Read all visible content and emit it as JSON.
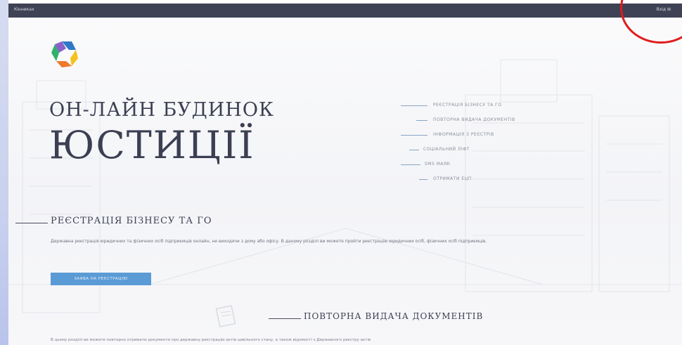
{
  "topbar": {
    "left_text": "Кінниках",
    "right_text": "Вхід ⊞"
  },
  "hero": {
    "line1": "ОН-ЛАЙН БУДИНОК",
    "line2": "ЮСТИЦІЇ"
  },
  "nav": {
    "items": [
      {
        "label": "РЕЄСТРАЦІЯ БІЗНЕСУ ТА ГО"
      },
      {
        "label": "ПОВТОРНА ВИДАЧА ДОКУМЕНТІВ"
      },
      {
        "label": "ІНФОРМАЦІЯ З РЕЄСТРІВ"
      },
      {
        "label": "СОЦІАЛЬНИЙ ЛІФТ"
      },
      {
        "label": "SMS МАЯК"
      },
      {
        "label": "ОТРИМАТИ ЕЦП"
      }
    ]
  },
  "section1": {
    "title": "РЕЄСТРАЦІЯ БІЗНЕСУ ТА ГО",
    "description": "Державна реєстрація юридичних та фізичних осіб підприємців онлайн, не виходячи з дому або офісу. В даному розділі ви можете пройти реєстрацію юридичних осіб, фізичних осіб підприємців.",
    "button_label": "ЗАЯВА НА РЕЄСТРАЦІЮ"
  },
  "section2": {
    "title": "ПОВТОРНА ВИДАЧА ДОКУМЕНТІВ",
    "description": "В цьому розділі ви можете повторно отримати документи про державну реєстрацію актів цивільного стану, а також відомості з Державного реєстру актів"
  },
  "colors": {
    "topbar": "#3f4254",
    "accent_button": "#5b9bd5",
    "heading": "#3b3f52",
    "annotation_circle": "#e01b1b"
  }
}
